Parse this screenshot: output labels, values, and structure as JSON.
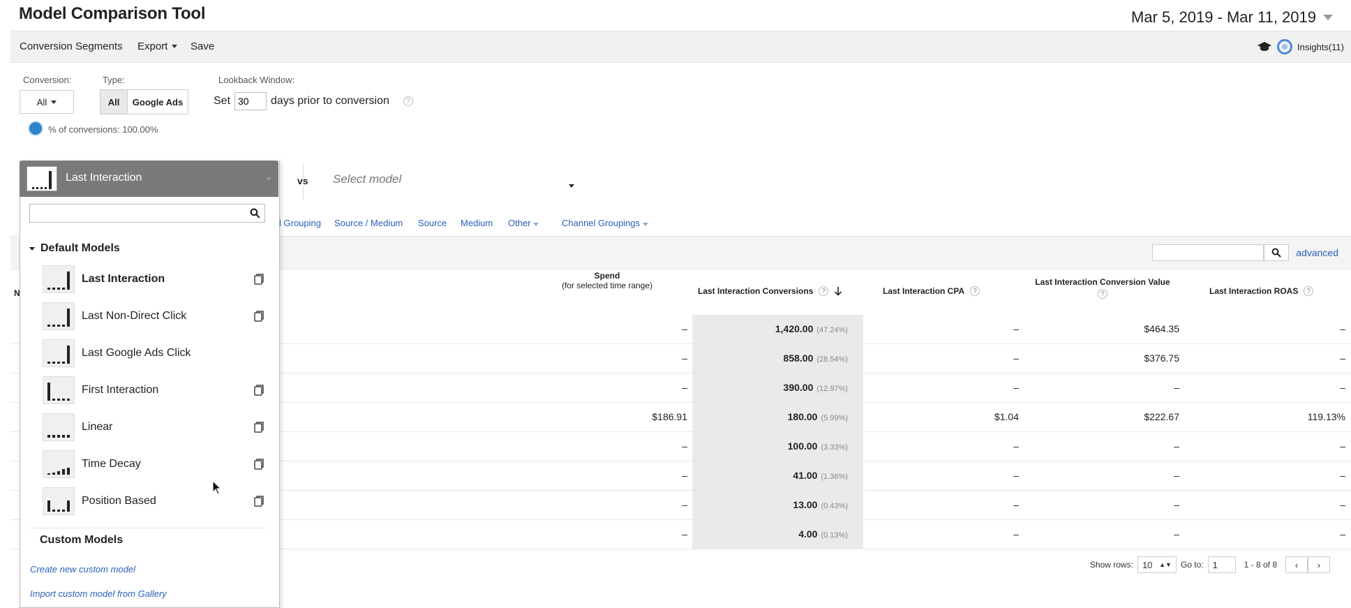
{
  "page_title": "Model Comparison Tool",
  "date_range": "Mar 5, 2019 - Mar 11, 2019",
  "toolbar": {
    "conversion_segments": "Conversion Segments",
    "export": "Export",
    "save": "Save",
    "insights": "Insights(11)"
  },
  "filters": {
    "conversion_label": "Conversion:",
    "conversion_value": "All",
    "type_label": "Type:",
    "type_all": "All",
    "type_google_ads": "Google Ads",
    "lookback_label": "Lookback Window:",
    "lookback_set": "Set",
    "lookback_days": "30",
    "lookback_suffix": "days prior to conversion",
    "help_glyph": "?",
    "pct_conversions": "% of conversions: 100.00%"
  },
  "model_selector": {
    "selected": "Last Interaction",
    "vs": "vs",
    "placeholder": "Select model"
  },
  "dimension_tabs": [
    "l Grouping",
    "Source / Medium",
    "Source",
    "Medium",
    "Other",
    "Channel Groupings"
  ],
  "search": {
    "advanced": "advanced"
  },
  "columns": {
    "spend": "Spend",
    "spend_sub": "(for selected time range)",
    "conversions": "Last Interaction Conversions",
    "cpa": "Last Interaction CPA",
    "conv_value": "Last Interaction Conversion Value",
    "roas": "Last Interaction ROAS",
    "n_fragment": "N"
  },
  "rows": [
    {
      "spend": "–",
      "conv": "1,420.00",
      "pct": "(47.24%)",
      "cpa": "–",
      "value": "$464.35",
      "roas": "–"
    },
    {
      "spend": "–",
      "conv": "858.00",
      "pct": "(28.54%)",
      "cpa": "–",
      "value": "$376.75",
      "roas": "–"
    },
    {
      "spend": "–",
      "conv": "390.00",
      "pct": "(12.97%)",
      "cpa": "–",
      "value": "–",
      "roas": "–"
    },
    {
      "spend": "$186.91",
      "conv": "180.00",
      "pct": "(5.99%)",
      "cpa": "$1.04",
      "value": "$222.67",
      "roas": "119.13%"
    },
    {
      "spend": "–",
      "conv": "100.00",
      "pct": "(3.33%)",
      "cpa": "–",
      "value": "–",
      "roas": "–"
    },
    {
      "spend": "–",
      "conv": "41.00",
      "pct": "(1.36%)",
      "cpa": "–",
      "value": "–",
      "roas": "–"
    },
    {
      "spend": "–",
      "conv": "13.00",
      "pct": "(0.43%)",
      "cpa": "–",
      "value": "–",
      "roas": "–"
    },
    {
      "spend": "–",
      "conv": "4.00",
      "pct": "(0.13%)",
      "cpa": "–",
      "value": "–",
      "roas": "–"
    }
  ],
  "pagination": {
    "show_rows_label": "Show rows:",
    "show_rows_value": "10",
    "goto_label": "Go to:",
    "goto_value": "1",
    "range": "1 - 8 of 8"
  },
  "dropdown": {
    "default_models_header": "Default Models",
    "models": [
      {
        "label": "Last Interaction",
        "bold": true,
        "copy": true,
        "pattern": "last"
      },
      {
        "label": "Last Non-Direct Click",
        "bold": false,
        "copy": true,
        "pattern": "last"
      },
      {
        "label": "Last Google Ads Click",
        "bold": false,
        "copy": false,
        "pattern": "last"
      },
      {
        "label": "First Interaction",
        "bold": false,
        "copy": true,
        "pattern": "first"
      },
      {
        "label": "Linear",
        "bold": false,
        "copy": true,
        "pattern": "linear"
      },
      {
        "label": "Time Decay",
        "bold": false,
        "copy": true,
        "pattern": "decay"
      },
      {
        "label": "Position Based",
        "bold": false,
        "copy": true,
        "pattern": "position"
      }
    ],
    "custom_models_header": "Custom Models",
    "create_link": "Create new custom model",
    "import_link": "Import custom model from Gallery"
  },
  "colors": {
    "link": "#2961b8",
    "accent_blue": "#2a86c8",
    "dropdown_header": "#7a7a7a"
  }
}
